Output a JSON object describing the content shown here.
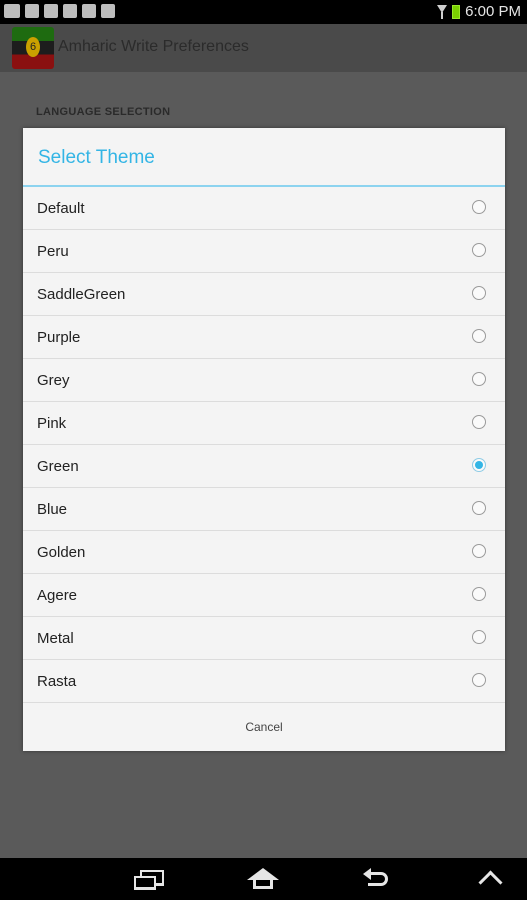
{
  "status_bar": {
    "time": "6:00 PM",
    "left_icons": [
      "gallery-icon",
      "chat-icon",
      "sync-icon",
      "download-icon",
      "download-icon",
      "download-icon"
    ],
    "right_icons": [
      "wifi-icon",
      "battery-icon"
    ]
  },
  "action_bar": {
    "title": "Amharic Write Preferences",
    "logo_badge": "6"
  },
  "background": {
    "section_header": "LANGUAGE SELECTION"
  },
  "dialog": {
    "title": "Select Theme",
    "title_color": "#33b5e5",
    "options": [
      {
        "label": "Default",
        "checked": false
      },
      {
        "label": "Peru",
        "checked": false
      },
      {
        "label": "SaddleGreen",
        "checked": false
      },
      {
        "label": "Purple",
        "checked": false
      },
      {
        "label": "Grey",
        "checked": false
      },
      {
        "label": "Pink",
        "checked": false
      },
      {
        "label": "Green",
        "checked": true
      },
      {
        "label": "Blue",
        "checked": false
      },
      {
        "label": "Golden",
        "checked": false
      },
      {
        "label": "Agere",
        "checked": false
      },
      {
        "label": "Metal",
        "checked": false
      },
      {
        "label": "Rasta",
        "checked": false
      }
    ],
    "cancel_label": "Cancel"
  },
  "nav_bar": {
    "buttons": [
      "recent-apps-icon",
      "home-icon",
      "back-icon",
      "up-icon"
    ]
  }
}
